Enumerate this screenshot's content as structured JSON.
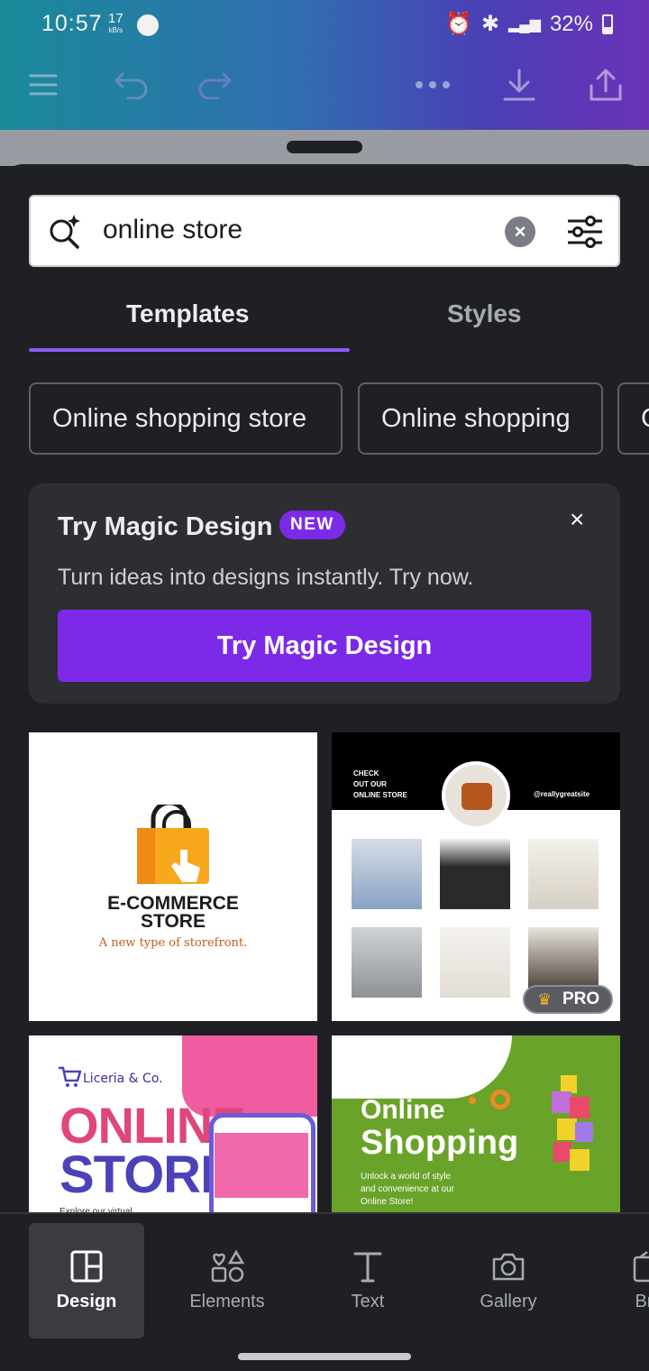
{
  "status_bar": {
    "time": "10:57",
    "net_speed": "17",
    "net_unit": "kB/s",
    "battery": "32%"
  },
  "toolbar": {
    "menu_icon": "hamburger-icon",
    "undo_icon": "undo-icon",
    "redo_icon": "redo-icon",
    "more_icon": "more-icon",
    "download_icon": "download-icon",
    "share_icon": "share-icon"
  },
  "search": {
    "value": "online store"
  },
  "tabs": [
    {
      "label": "Templates",
      "active": true
    },
    {
      "label": "Styles",
      "active": false
    }
  ],
  "chips": [
    "Online shopping store",
    "Online shopping",
    "C"
  ],
  "magic_design": {
    "title": "Try Magic Design",
    "badge": "NEW",
    "close": "×",
    "description": "Turn ideas into designs instantly. Try now.",
    "button": "Try Magic Design",
    "accent": "#7d2ae8"
  },
  "templates": {
    "card1": {
      "line1": "E-COMMERCE",
      "line2": "STORE",
      "tagline": "A new type of storefront."
    },
    "card2": {
      "check1": "CHECK",
      "check2": "OUT OUR",
      "check3": "ONLINE STORE",
      "handle": "@reallygreatsite",
      "pro_label": "PRO"
    },
    "card3": {
      "brand": "Liceria & Co.",
      "online": "ONLINE",
      "store": "STORE",
      "explore": "Explore our virtual"
    },
    "card4": {
      "title1": "Online",
      "title2": "Shopping",
      "sub1": "Unlock a world of style",
      "sub2": "and convenience at our",
      "sub3": "Online Store!"
    }
  },
  "bottom_nav": [
    {
      "label": "Design",
      "active": true
    },
    {
      "label": "Elements",
      "active": false
    },
    {
      "label": "Text",
      "active": false
    },
    {
      "label": "Gallery",
      "active": false
    },
    {
      "label": "Bra",
      "active": false
    }
  ]
}
